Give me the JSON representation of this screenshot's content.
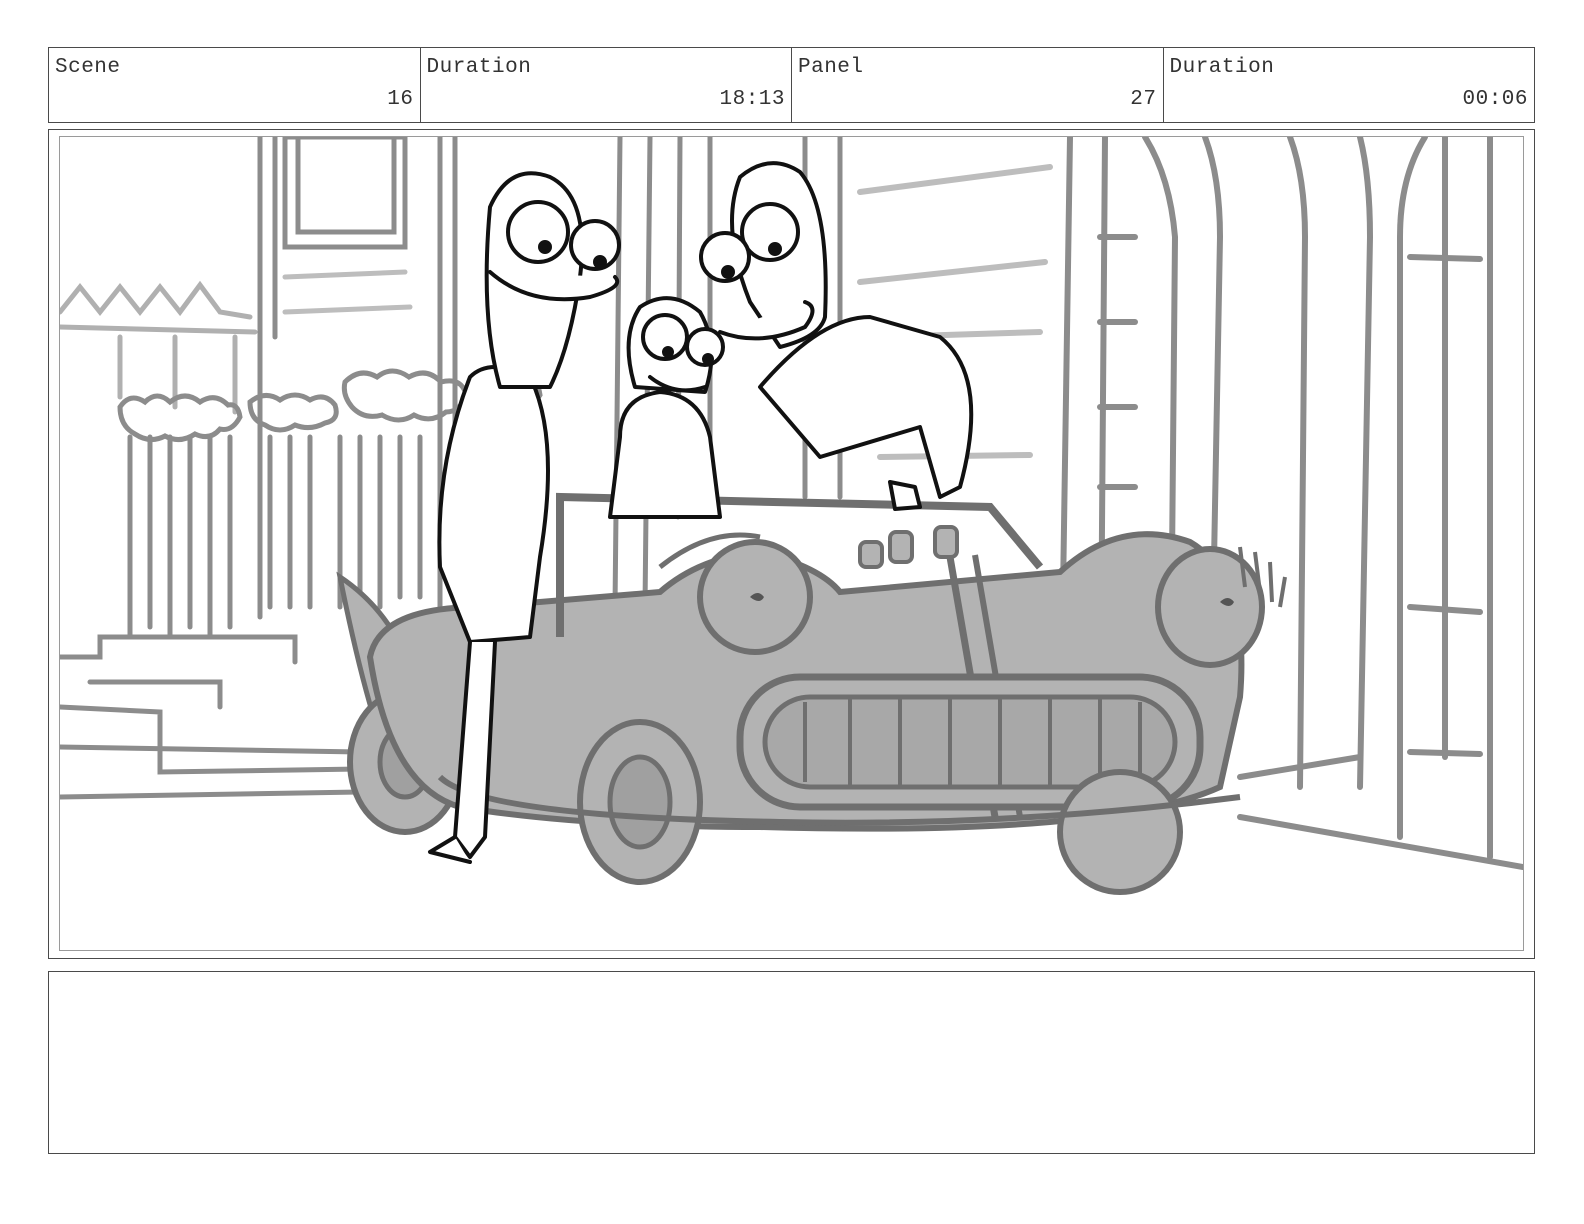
{
  "header": {
    "cells": [
      {
        "label": "Scene",
        "value": "16"
      },
      {
        "label": "Duration",
        "value": "18:13"
      },
      {
        "label": "Panel",
        "value": "27"
      },
      {
        "label": "Duration",
        "value": "00:06"
      }
    ]
  },
  "panel": {
    "illustration": "storyboard-sketch"
  },
  "notes": {
    "text": ""
  },
  "colors": {
    "border": "#4a4a4a",
    "sketch_gray": "#8c8c8c",
    "car_fill": "#b3b3b3",
    "ink": "#111111"
  }
}
